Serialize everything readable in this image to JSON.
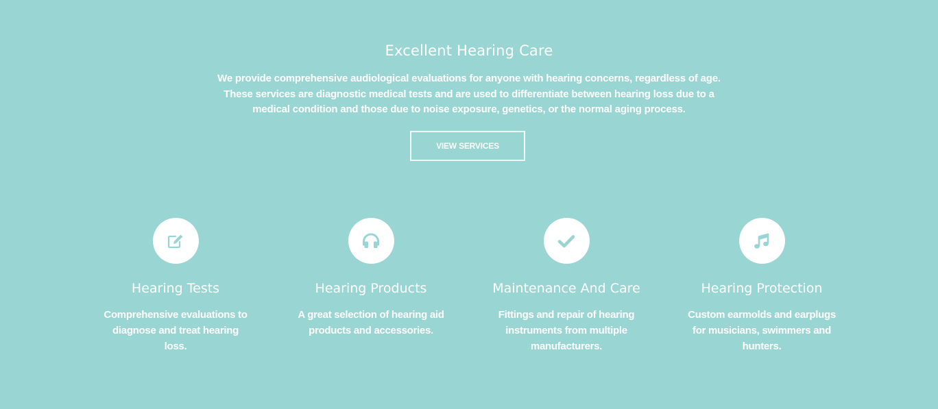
{
  "hero": {
    "title": "Excellent Hearing Care",
    "description": "We provide comprehensive audiological evaluations for anyone with hearing concerns, regardless of age. These services are diagnostic medical tests and are used to differentiate between hearing loss due to a medical condition and those due to noise exposure, genetics, or the normal aging process.",
    "button_label": "VIEW SERVICES"
  },
  "features": [
    {
      "icon": "edit-icon",
      "title": "Hearing Tests",
      "description": "Comprehensive evaluations to diagnose and treat hearing loss."
    },
    {
      "icon": "headphones-icon",
      "title": "Hearing Products",
      "description": "A great selection of hearing aid products and accessories."
    },
    {
      "icon": "check-icon",
      "title": "Maintenance And Care",
      "description": "Fittings and repair of hearing instruments from multiple manufacturers."
    },
    {
      "icon": "music-note-icon",
      "title": "Hearing Protection",
      "description": "Custom earmolds and earplugs for musicians, swimmers and hunters."
    }
  ],
  "colors": {
    "background": "#99d5d2",
    "text": "#ffffff",
    "icon_circle": "#ffffff",
    "icon_glyph": "#99d5d2"
  }
}
